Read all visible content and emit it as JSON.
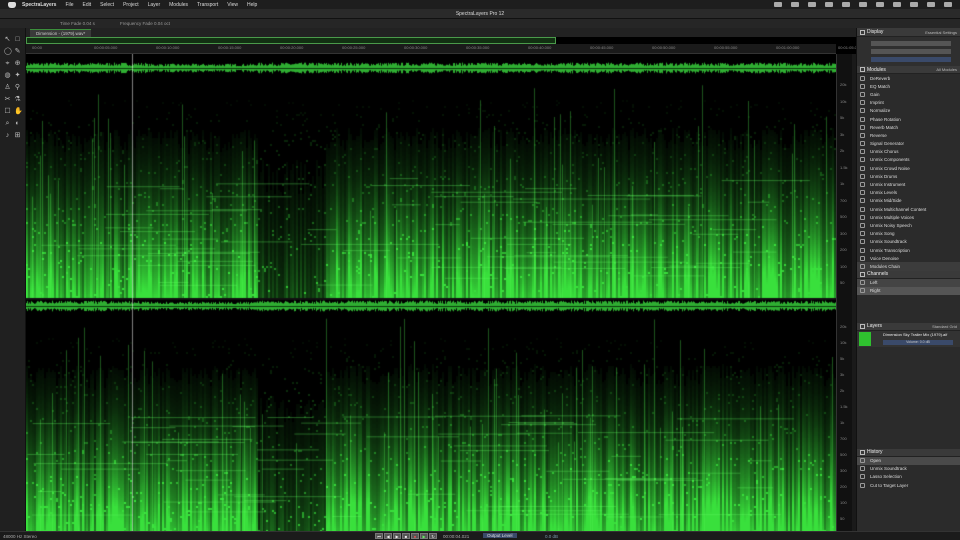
{
  "menubar": {
    "app_name": "SpectraLayers",
    "items": [
      "File",
      "Edit",
      "Select",
      "Project",
      "Layer",
      "Modules",
      "Transport",
      "View",
      "Help"
    ]
  },
  "window": {
    "title": "SpectraLayers Pro 12"
  },
  "toolbar": {
    "time_fade": "Time Fade 0.04 s",
    "frequency_fade": "Frequency Fade 0.04 oct"
  },
  "tab": {
    "label": "Dimension - (1979).wav*"
  },
  "timeline": {
    "ticks": [
      "00:00",
      "00:00:05.000",
      "00:00:10.000",
      "00:00:15.000",
      "00:00:20.000",
      "00:00:25.000",
      "00:00:30.000",
      "00:00:35.000",
      "00:00:40.000",
      "00:00:45.000",
      "00:00:50.000",
      "00:00:55.000",
      "00:01:00.000",
      "00:01:05.000"
    ]
  },
  "ruler": {
    "labels_top": [
      "20k",
      "10k",
      "5k",
      "3k",
      "2k",
      "1.5k",
      "1k",
      "700",
      "500",
      "300",
      "200",
      "100",
      "50"
    ],
    "labels_bottom": [
      "20k",
      "10k",
      "5k",
      "3k",
      "2k",
      "1.5k",
      "1k",
      "700",
      "500",
      "300",
      "200",
      "100",
      "50"
    ]
  },
  "display_panel": {
    "title": "Display",
    "preset": "Essential Settings"
  },
  "modules_panel": {
    "title": "Modules",
    "filter": "All Modules",
    "items": [
      "DeReverb",
      "EQ Match",
      "Gain",
      "Imprint",
      "Normalize",
      "Phase Rotation",
      "Reverb Match",
      "Reverse",
      "Signal Generator",
      "Unmix Chorus",
      "Unmix Components",
      "Unmix Crowd Noise",
      "Unmix Drums",
      "Unmix Instrument",
      "Unmix Levels",
      "Unmix Mid/Side",
      "Unmix Multichannel Content",
      "Unmix Multiple Voices",
      "Unmix Noisy Speech",
      "Unmix Song",
      "Unmix Soundtrack",
      "Unmix Transcription",
      "Voice Denoise",
      "Modules Chain"
    ]
  },
  "channels_panel": {
    "title": "Channels",
    "items": [
      "Left",
      "Right"
    ]
  },
  "layers_panel": {
    "title": "Layers",
    "mode": "Standard Grid",
    "layer_name": "Dimension Sky Trailer Mix (1979).aif",
    "sub": "Volume: 0.0 dB"
  },
  "history_panel": {
    "title": "History",
    "items": [
      "Open",
      "Unmix Soundtrack",
      "Lasso Selection",
      "Cut to Target Layer"
    ]
  },
  "statusbar": {
    "format": "48000 Hz Stereo",
    "time": "00:00:04.021",
    "output_label": "Output Level",
    "output_val": "0.0 dB"
  },
  "colors": {
    "spectrum": "#39e03c",
    "accent": "#4a9a4a",
    "panel_bg": "#2b2b2b"
  }
}
